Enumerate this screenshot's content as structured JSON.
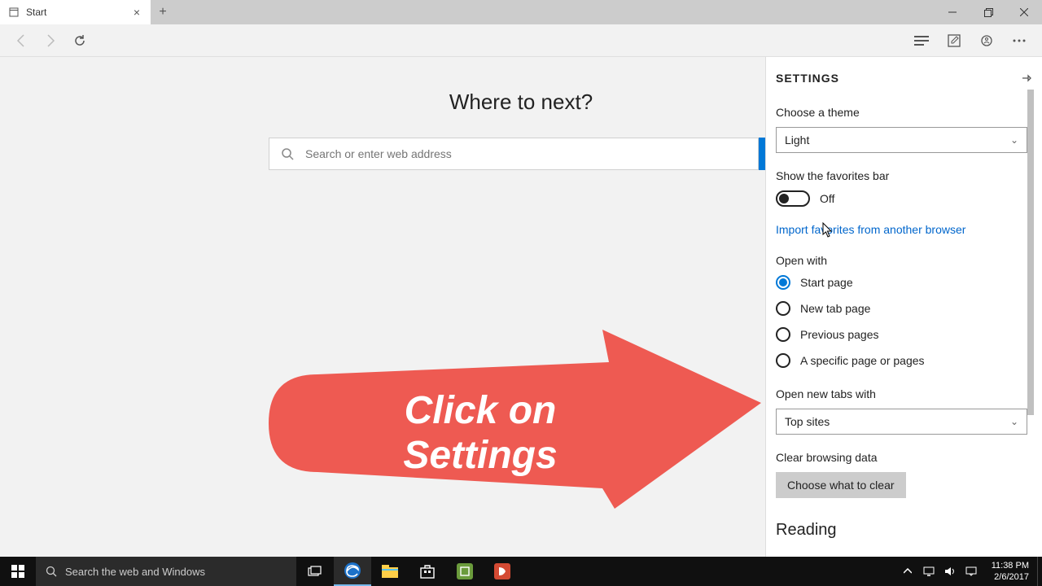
{
  "tab": {
    "title": "Start"
  },
  "start_page": {
    "heading": "Where to next?",
    "search_placeholder": "Search or enter web address"
  },
  "settings": {
    "title": "SETTINGS",
    "theme_label": "Choose a theme",
    "theme_value": "Light",
    "favorites_bar_label": "Show the favorites bar",
    "favorites_bar_state": "Off",
    "import_link": "Import favorites from another browser",
    "open_with_label": "Open with",
    "open_with_options": [
      "Start page",
      "New tab page",
      "Previous pages",
      "A specific page or pages"
    ],
    "open_with_selected": 0,
    "open_new_tabs_label": "Open new tabs with",
    "open_new_tabs_value": "Top sites",
    "clear_data_label": "Clear browsing data",
    "clear_data_button": "Choose what to clear",
    "reading_heading": "Reading"
  },
  "annotation": {
    "line1": "Click on",
    "line2": "Settings",
    "color": "#ee5a52"
  },
  "taskbar": {
    "search_placeholder": "Search the web and Windows",
    "time": "11:38 PM",
    "date": "2/6/2017"
  }
}
